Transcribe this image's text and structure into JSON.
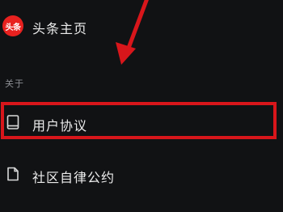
{
  "menu": {
    "homepage": {
      "logo_text": "头条",
      "label": "头条主页"
    },
    "about_section": {
      "header": "关于",
      "items": [
        {
          "label": "用户协议",
          "icon": "book-icon"
        },
        {
          "label": "社区自律公约",
          "icon": "document-icon"
        }
      ]
    }
  },
  "annotation": {
    "highlight_color": "#d8161b",
    "arrow_color": "#d8161b"
  },
  "colors": {
    "background": "#111214",
    "logo_red": "#e8211f",
    "section_header": "#8d8f94"
  }
}
